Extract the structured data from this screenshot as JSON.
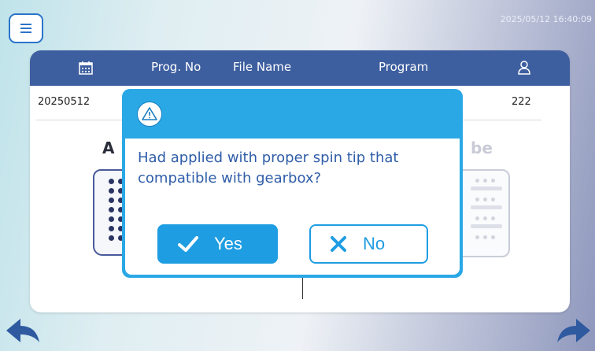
{
  "header": {
    "datetime": "2025/05/12 16:40:09"
  },
  "table": {
    "columns": [
      "Prog. No",
      "File Name",
      "Program"
    ],
    "row": {
      "date": "20250512",
      "user": "222"
    }
  },
  "panels": {
    "left_letter": "A",
    "right_fragment": "be"
  },
  "dialog": {
    "message_line1": "Had applied with proper spin tip that",
    "message_line2": "compatible with gearbox?",
    "yes_label": "Yes",
    "no_label": "No"
  },
  "colors": {
    "header_blue": "#3e5f9f",
    "dialog_blue": "#2aa8e6",
    "button_blue": "#1f9de2",
    "message_text": "#2f5da8"
  },
  "icons": [
    "menu-icon",
    "calendar-icon",
    "user-icon",
    "warning-icon",
    "check-icon",
    "x-icon",
    "back-arrow-icon",
    "next-arrow-icon"
  ]
}
